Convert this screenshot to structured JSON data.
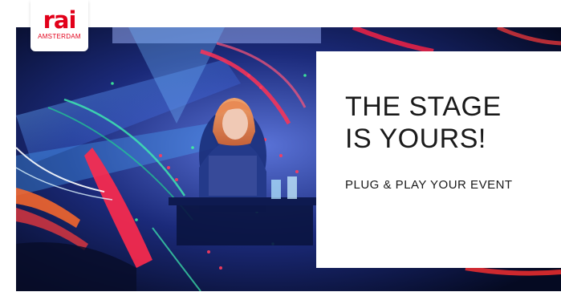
{
  "logo": {
    "brand": "rai",
    "city": "AMSTERDAM"
  },
  "hero": {
    "headline": [
      "THE STAGE",
      "IS YOURS!"
    ],
    "subheadline": "PLUG & PLAY YOUR EVENT"
  },
  "colors": {
    "brand_red": "#e2001a",
    "card_bg": "#ffffff",
    "text": "#1a1a1a"
  }
}
